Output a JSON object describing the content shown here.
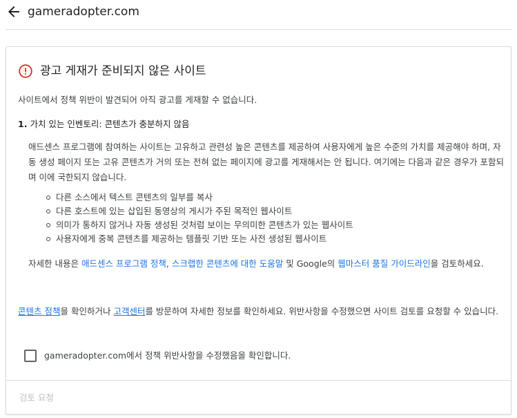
{
  "header": {
    "back_icon": "arrow-left-icon",
    "site_title": "gameradopter.com"
  },
  "card": {
    "icon": "error-circle-icon",
    "icon_color": "#d93025",
    "title": "광고 게재가 준비되지 않은 사이트",
    "intro": "사이트에서 정책 위반이 발견되어 아직 광고를 게재할 수 없습니다.",
    "section": {
      "number": "1.",
      "title": "가치 있는 인벤토리: 콘텐츠가 충분하지 않음",
      "body": "애드센스 프로그램에 참여하는 사이트는 고유하고 관련성 높은 콘텐츠를 제공하여 사용자에게 높은 수준의 가치를 제공해야 하며, 자동 생성 페이지 또는 고유 콘텐츠가 거의 또는 전혀 없는 페이지에 광고를 게재해서는 안 됩니다. 여기에는 다음과 같은 경우가 포함되며 이에 국한되지 않습니다.",
      "bullets": [
        "다른 소스에서 텍스트 콘텐츠의 일부를 복사",
        "다른 호스트에 있는 삽입된 동영상의 게시가 주된 목적인 웹사이트",
        "의미가 통하지 않거나 자동 생성된 것처럼 보이는 무의미한 콘텐츠가 있는 웹사이트",
        "사용자에게 중복 콘텐츠를 제공하는 템플릿 기반 또는 사전 생성된 웹사이트"
      ],
      "more_info": {
        "prefix": "자세한 내용은 ",
        "link1": "애드센스 프로그램 정책",
        "sep1": ", ",
        "link2": "스크랩한 콘텐츠에 대한 도움말",
        "sep2": " 및 Google의 ",
        "link3": "웹마스터 품질 가이드라인",
        "suffix": "을 검토하세요."
      }
    },
    "policy_check": {
      "link1": "콘텐츠 정책",
      "text1": "을 확인하거나 ",
      "link2": "고객센터",
      "text2": "를 방문하여 자세한 정보를 확인하세요. 위반사항을 수정했으면 사이트 검토를 요청할 수 있습니다."
    },
    "confirm": {
      "label": "gameradopter.com에서 정책 위반사항을 수정했음을 확인합니다.",
      "checked": false
    },
    "review_button": "검토 요청"
  },
  "colors": {
    "link": "#1a73e8",
    "error": "#d93025",
    "disabled": "#bdc1c6"
  }
}
